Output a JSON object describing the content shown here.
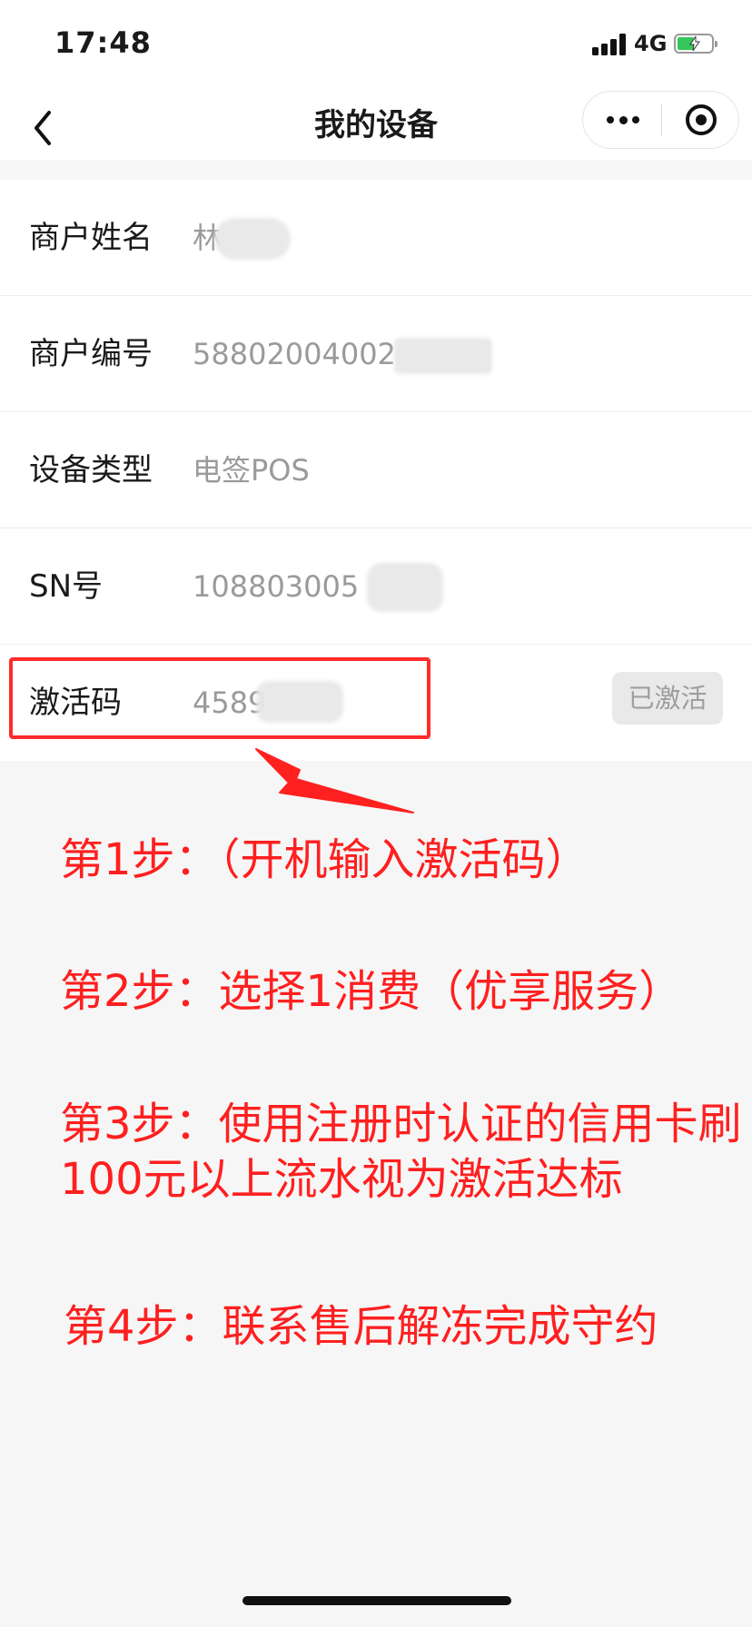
{
  "status": {
    "time": "17:48",
    "network": "4G"
  },
  "nav": {
    "title": "我的设备"
  },
  "rows": [
    {
      "label": "商户姓名",
      "value": "林"
    },
    {
      "label": "商户编号",
      "value": "58802004002"
    },
    {
      "label": "设备类型",
      "value": "电签POS"
    },
    {
      "label": "SN号",
      "value": "108803005"
    },
    {
      "label": "激活码",
      "value": "4589",
      "button": "已激活"
    }
  ],
  "annotation": {
    "color": "#ff1f1f",
    "steps": [
      "第1步：（开机输入激活码）",
      "第2步：选择1消费（优享服务）",
      "第3步：使用注册时认证的信用卡刷",
      "100元以上流水视为激活达标",
      "第4步：联系售后解冻完成守约"
    ]
  }
}
